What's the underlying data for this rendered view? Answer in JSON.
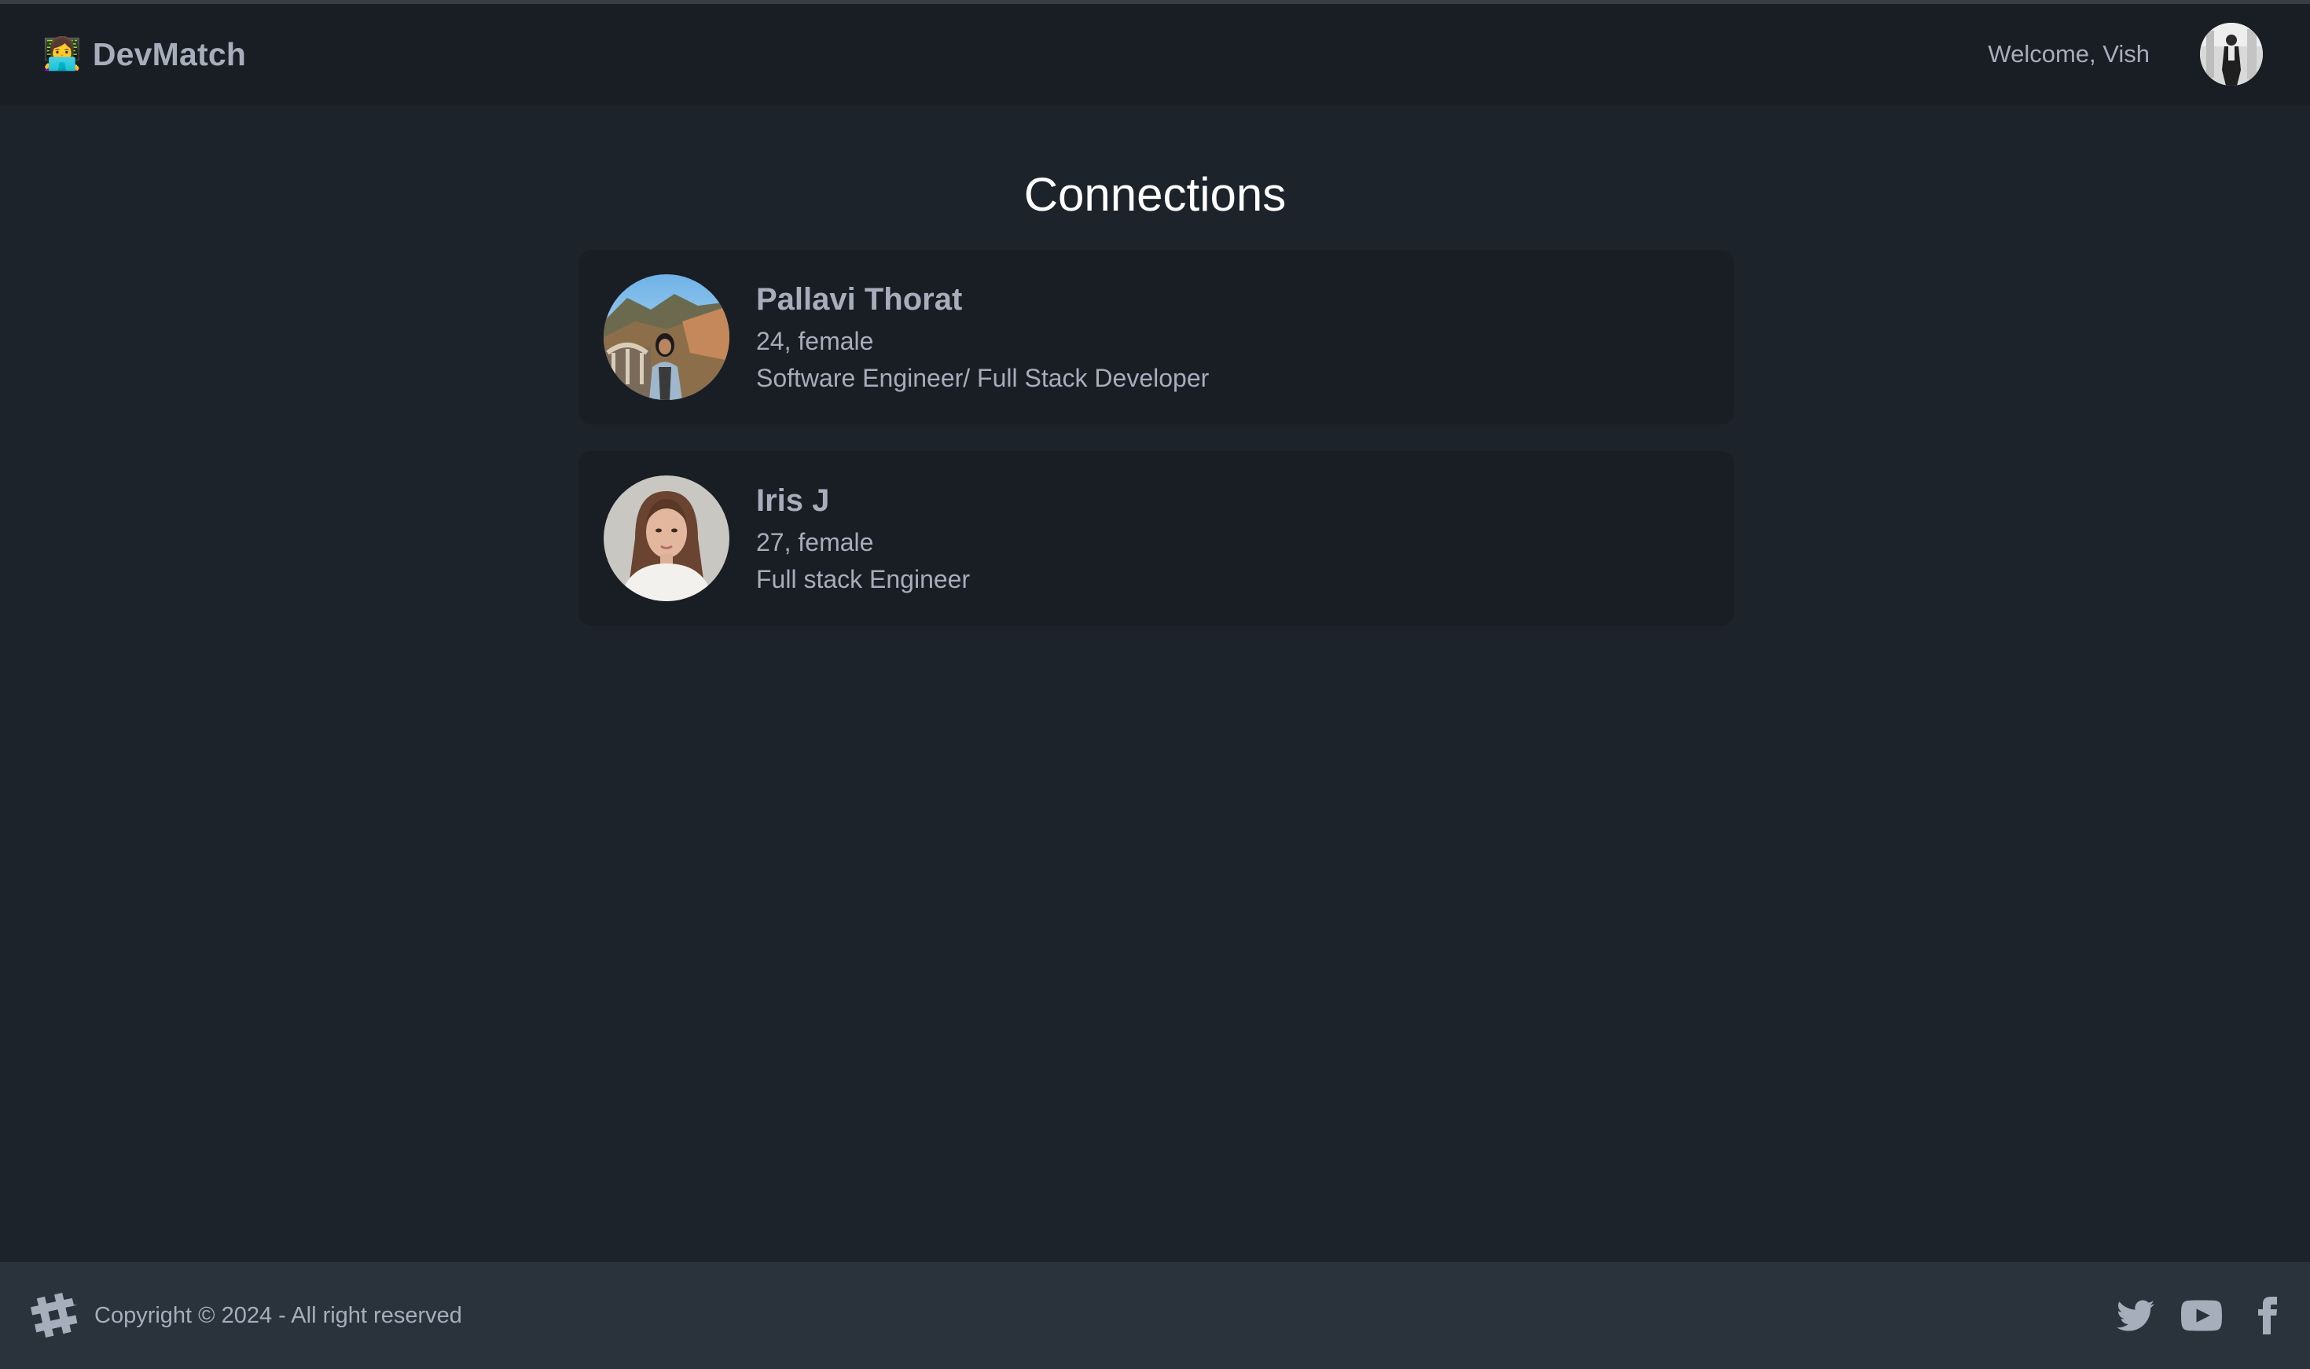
{
  "navbar": {
    "brand_emoji": "👩‍💻",
    "brand_label": "DevMatch",
    "welcome_text": "Welcome, Vish"
  },
  "page": {
    "title": "Connections"
  },
  "connections": [
    {
      "name": "Pallavi Thorat",
      "age_gender": "24, female",
      "about": "Software Engineer/ Full Stack Developer"
    },
    {
      "name": "Iris J",
      "age_gender": "27, female",
      "about": "Full stack Engineer"
    }
  ],
  "footer": {
    "copyright": "Copyright © 2024 - All right reserved",
    "social_icons": [
      "twitter-icon",
      "youtube-icon",
      "facebook-icon"
    ]
  },
  "colors": {
    "background": "#1d232a",
    "navbar": "#191e24",
    "card": "#191e24",
    "footer": "#2a323c",
    "text": "#a6adbb",
    "title": "#ffffff"
  }
}
